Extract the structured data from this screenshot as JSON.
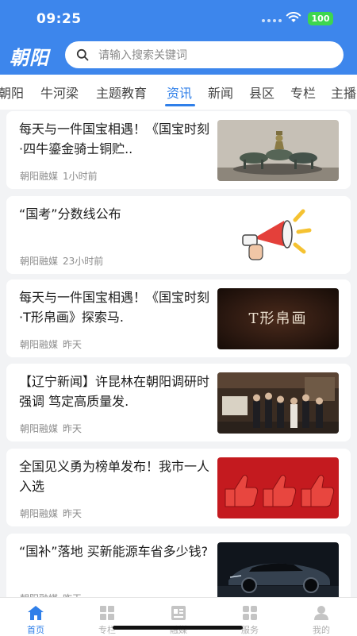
{
  "status_bar": {
    "time": "09:25",
    "battery": "100"
  },
  "header": {
    "logo_text": "朝阳",
    "search_placeholder": "请输入搜索关键词"
  },
  "tabs": [
    {
      "label": "朝阳"
    },
    {
      "label": "牛河梁"
    },
    {
      "label": "主题教育"
    },
    {
      "label": "资讯",
      "active": true
    },
    {
      "label": "新闻"
    },
    {
      "label": "县区"
    },
    {
      "label": "专栏"
    },
    {
      "label": "主播"
    }
  ],
  "news": [
    {
      "title": "每天与一件国宝相遇！《国宝时刻·四牛鎏金骑士铜贮..",
      "source": "朝阳融媒",
      "time": "1小时前",
      "thumb": "bronze-statue-photo"
    },
    {
      "title": "“国考”分数线公布",
      "source": "朝阳融媒",
      "time": "23小时前",
      "thumb": "megaphone-illustration"
    },
    {
      "title": "每天与一件国宝相遇！《国宝时刻·T形帛画》探索马.",
      "source": "朝阳融媒",
      "time": "昨天",
      "thumb": "t-shaped-silk-painting-card",
      "thumb_text": "T形帛画"
    },
    {
      "title": "【辽宁新闻】许昆林在朝阳调研时强调 笃定高质量发.",
      "source": "朝阳融媒",
      "time": "昨天",
      "thumb": "exhibition-visit-photo"
    },
    {
      "title": "全国见义勇为榜单发布！我市一人入选",
      "source": "朝阳融媒",
      "time": "昨天",
      "thumb": "thumbs-up-banner"
    },
    {
      "title": "“国补”落地 买新能源车省多少钱?",
      "source": "朝阳融媒",
      "time": "昨天",
      "thumb": "electric-car-photo"
    }
  ],
  "bottom_nav": [
    {
      "label": "首页",
      "icon": "home-icon",
      "active": true
    },
    {
      "label": "专栏",
      "icon": "column-icon"
    },
    {
      "label": "融媒",
      "icon": "media-icon"
    },
    {
      "label": "服务",
      "icon": "service-icon"
    },
    {
      "label": "我的",
      "icon": "profile-icon"
    }
  ],
  "colors": {
    "brand_blue": "#3d86ec",
    "active_tab": "#2f7fe9",
    "background": "#f2f3f5"
  }
}
